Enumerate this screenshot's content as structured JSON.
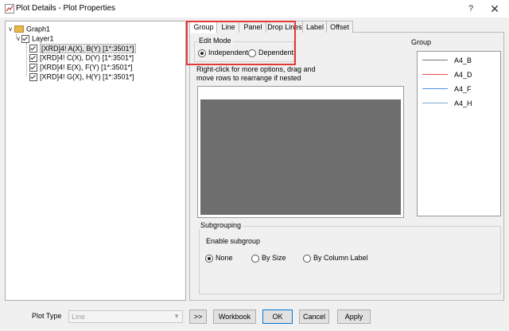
{
  "window": {
    "title": "Plot Details - Plot Properties",
    "help_glyph": "?",
    "close_glyph": "✕"
  },
  "tree": {
    "expand_glyph": "∨",
    "root": "Graph1",
    "layer": "Layer1",
    "plots": [
      "[XRD]4! A(X), B(Y) [1*:3501*]",
      "[XRD]4! C(X), D(Y) [1*:3501*]",
      "[XRD]4! E(X), F(Y) [1*:3501*]",
      "[XRD]4! G(X), H(Y) [1*:3501*]"
    ]
  },
  "tabs": [
    "Group",
    "Line",
    "Panel",
    "Drop Lines",
    "Label",
    "Offset"
  ],
  "edit_mode": {
    "title": "Edit Mode",
    "options": [
      "Independent",
      "Dependent"
    ],
    "selected": "Independent"
  },
  "hint": {
    "line1": "Right-click for more options, drag and",
    "line2": "move rows to  rearrange if nested"
  },
  "group_label": "Group",
  "legend": [
    {
      "name": "A4_B",
      "color": "#777777"
    },
    {
      "name": "A4_D",
      "color": "#e85050"
    },
    {
      "name": "A4_F",
      "color": "#4f8fe8"
    },
    {
      "name": "A4_H",
      "color": "#7fa7d0"
    }
  ],
  "subgrouping": {
    "title": "Subgrouping",
    "enable_label": "Enable subgroup",
    "options": [
      "None",
      "By Size",
      "By Column Label"
    ],
    "selected": "None"
  },
  "bottom": {
    "plot_type_label": "Plot Type",
    "plot_type_value": "Line",
    "dropdown_glyph": "▼",
    "expand_label": ">>",
    "workbook": "Workbook",
    "ok": "OK",
    "cancel": "Cancel",
    "apply": "Apply"
  }
}
